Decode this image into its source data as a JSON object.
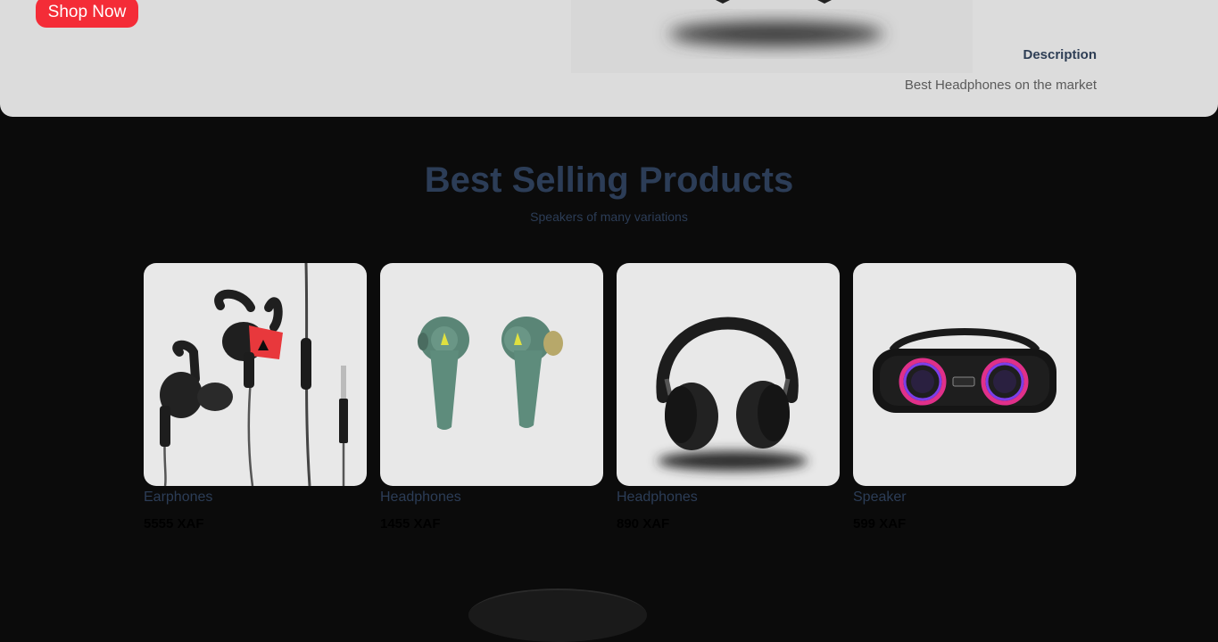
{
  "hero": {
    "shop_button": "Shop Now",
    "description_title": "Description",
    "description_text": "Best Headphones on the market"
  },
  "section": {
    "title": "Best Selling Products",
    "subtitle": "Speakers of many variations"
  },
  "products": [
    {
      "name": "Earphones",
      "price": "5555 XAF",
      "icon": "earphones-icon"
    },
    {
      "name": "Headphones",
      "price": "1455 XAF",
      "icon": "earbuds-icon"
    },
    {
      "name": "Headphones",
      "price": "890 XAF",
      "icon": "headphones-icon"
    },
    {
      "name": "Speaker",
      "price": "599 XAF",
      "icon": "speaker-icon"
    }
  ],
  "colors": {
    "accent": "#f42c37",
    "heading": "#2c3d57",
    "background": "#0b0b0b",
    "hero_bg": "#dcdcdc",
    "card_bg": "#e8e8e8"
  }
}
